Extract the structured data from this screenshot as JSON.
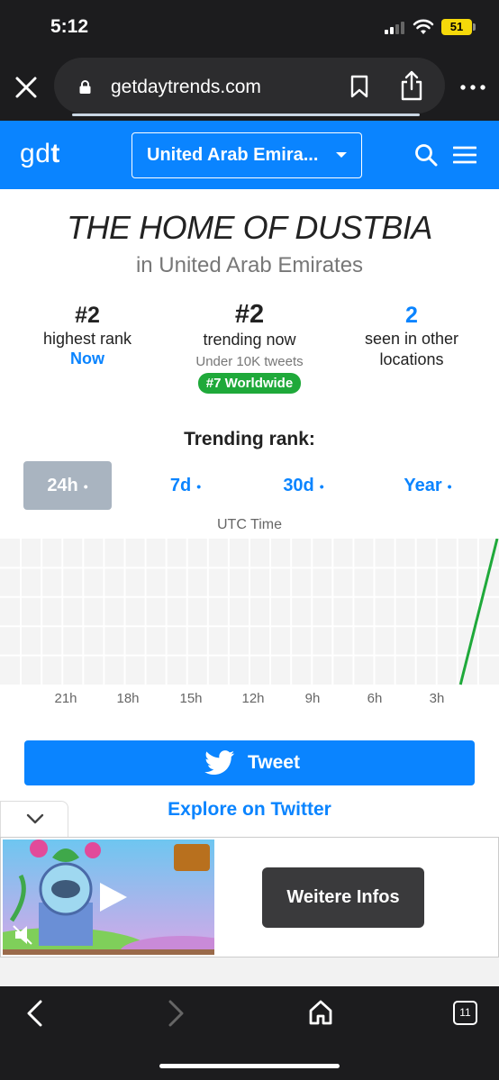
{
  "status_bar": {
    "time": "5:12",
    "battery": "51"
  },
  "browser": {
    "url": "getdaytrends.com"
  },
  "site": {
    "logo_g": "g",
    "logo_d": "d",
    "logo_t": "t",
    "country_selected": "United Arab Emira..."
  },
  "trend": {
    "title": "THE HOME OF DUSTBIA",
    "subtitle": "in United Arab Emirates"
  },
  "stats": {
    "highest_rank_value": "#2",
    "highest_rank_label": "highest rank",
    "highest_rank_when": "Now",
    "trending_now_value": "#2",
    "trending_now_label": "trending now",
    "tweet_volume": "Under 10K tweets",
    "worldwide_badge": "#7 Worldwide",
    "locations_value": "2",
    "locations_label_1": "seen in other",
    "locations_label_2": "locations"
  },
  "rank_heading": "Trending rank:",
  "tabs": [
    {
      "label": "24h",
      "dot": "•",
      "active": true
    },
    {
      "label": "7d",
      "dot": "•",
      "active": false
    },
    {
      "label": "30d",
      "dot": "•",
      "active": false
    },
    {
      "label": "Year",
      "dot": "•",
      "active": false
    }
  ],
  "chart_data": {
    "type": "line",
    "title": "UTC Time",
    "x_tick_labels": [
      "21h",
      "18h",
      "15h",
      "12h",
      "9h",
      "6h",
      "3h"
    ],
    "series": [
      {
        "color": "#1fa93a",
        "x_hours_ago": [
          0.9,
          0.0
        ],
        "rank_fraction_from_top": [
          1.0,
          0.0
        ]
      }
    ],
    "grid": true
  },
  "tweet_button": {
    "label": "Tweet"
  },
  "explore_link": "Explore on Twitter",
  "ad": {
    "cta_label": "Weitere Infos"
  },
  "toolbar": {
    "tab_count": "11"
  },
  "colors": {
    "accent": "#0a84ff",
    "badge_green": "#1fa93a",
    "chrome_dark": "#1c1c1e"
  }
}
